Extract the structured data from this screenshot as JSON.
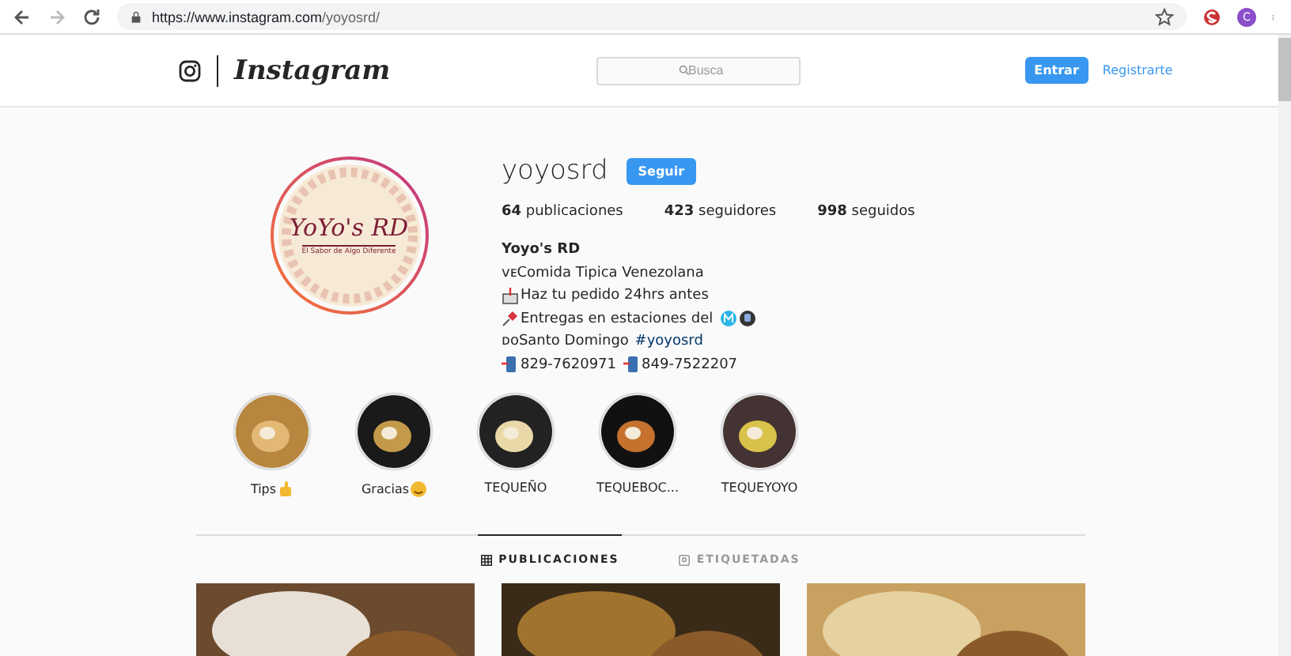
{
  "browser": {
    "url_host": "https://www.instagram.com",
    "url_path": "/yoyosrd/",
    "profile_initial": "C"
  },
  "header": {
    "logo": "Instagram",
    "search": {
      "placeholder": "Busca"
    },
    "login": "Entrar",
    "signup": "Registrarte"
  },
  "profile": {
    "logo_title": "YoYo's RD",
    "logo_subtitle": "El Sabor de Algo Diferente",
    "username": "yoyosrd",
    "follow": "Seguir",
    "stats": [
      "**64** publicaciones",
      "**423** seguidores",
      "**998** seguidos"
    ],
    "name": "Yoyo's RD",
    "bio": [
      {
        "kind": "text",
        "text": "ᴠᴇComida Tipica Venezolana"
      },
      {
        "kind": "inbox",
        "text": "Haz tu pedido 24hrs antes"
      },
      {
        "kind": "pin",
        "text": "Entregas en estaciones del"
      },
      {
        "kind": "place",
        "text": "ᴅᴏSanto Domingo ",
        "tag": "#yoyosrd"
      },
      {
        "kind": "phones",
        "phones": [
          "829-7620971",
          "849-7522207"
        ]
      }
    ]
  },
  "highlights": [
    {
      "label": "Tips",
      "kind": "hand"
    },
    {
      "label": "Gracias",
      "kind": "smile"
    },
    {
      "label": "TEQUEÑO",
      "kind": "plain"
    },
    {
      "label": "TEQUEBOC...",
      "kind": "plain"
    },
    {
      "label": "TEQUEYOYO",
      "kind": "plain"
    }
  ],
  "tabs": [
    {
      "label": "PUBLICACIONES",
      "selected": true
    },
    {
      "label": "ETIQUETADAS",
      "selected": false
    }
  ]
}
